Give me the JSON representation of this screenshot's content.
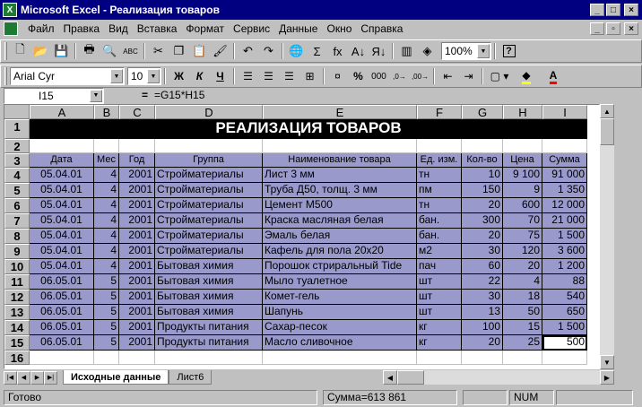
{
  "window": {
    "title": "Microsoft Excel - Реализация товаров",
    "controls": [
      "_",
      "□",
      "×"
    ],
    "doc_controls": [
      "_",
      "▫",
      "×"
    ]
  },
  "menu": [
    "Файл",
    "Правка",
    "Вид",
    "Вставка",
    "Формат",
    "Сервис",
    "Данные",
    "Окно",
    "Справка"
  ],
  "toolbar": {
    "standard": [
      {
        "name": "new-icon",
        "glyph": "🗋"
      },
      {
        "name": "open-icon",
        "glyph": "📂"
      },
      {
        "name": "save-icon",
        "glyph": "💾"
      },
      {
        "name": "print-icon",
        "glyph": "🖶"
      },
      {
        "name": "print-preview-icon",
        "glyph": "🔍"
      },
      {
        "name": "spelling-icon",
        "glyph": "ABC"
      },
      {
        "name": "cut-icon",
        "glyph": "✂"
      },
      {
        "name": "copy-icon",
        "glyph": "❐"
      },
      {
        "name": "paste-icon",
        "glyph": "📋"
      },
      {
        "name": "format-painter-icon",
        "glyph": "🖌"
      },
      {
        "name": "undo-icon",
        "glyph": "↶"
      },
      {
        "name": "redo-icon",
        "glyph": "↷"
      },
      {
        "name": "hyperlink-icon",
        "glyph": "🌐"
      },
      {
        "name": "autosum-icon",
        "glyph": "Σ"
      },
      {
        "name": "function-icon",
        "glyph": "fx"
      },
      {
        "name": "sort-ascending-icon",
        "glyph": "A↓"
      },
      {
        "name": "sort-descending-icon",
        "glyph": "Я↓"
      },
      {
        "name": "chart-wizard-icon",
        "glyph": "▥"
      },
      {
        "name": "drawing-icon",
        "glyph": "◈"
      }
    ],
    "zoom": "100%",
    "help": "?"
  },
  "formatting": {
    "font": "Arial Cyr",
    "size": "10",
    "bold": "Ж",
    "italic": "К",
    "underline": "Ч",
    "currency": "%",
    "thousands": "000",
    "inc_decimal": ",0→,00",
    "dec_decimal": ",00→,0"
  },
  "formula_bar": {
    "name_box": "I15",
    "equals": "=",
    "formula": "=G15*H15"
  },
  "columns": [
    "A",
    "B",
    "C",
    "D",
    "E",
    "F",
    "G",
    "H",
    "I"
  ],
  "row_numbers": [
    "1",
    "2",
    "3",
    "4",
    "5",
    "6",
    "7",
    "8",
    "9",
    "10",
    "11",
    "12",
    "13",
    "14",
    "15",
    "16"
  ],
  "sheet_title": "РЕАЛИЗАЦИЯ ТОВАРОВ",
  "table_headers": [
    "Дата",
    "Мес",
    "Год",
    "Группа",
    "Наименование товара",
    "Ед. изм.",
    "Кол-во",
    "Цена",
    "Сумма"
  ],
  "table_rows": [
    [
      "05.04.01",
      "4",
      "2001",
      "Стройматериалы",
      "Лист 3 мм",
      "тн",
      "10",
      "9 100",
      "91 000"
    ],
    [
      "05.04.01",
      "4",
      "2001",
      "Стройматериалы",
      "Труба Д50, толщ. 3 мм",
      "пм",
      "150",
      "9",
      "1 350"
    ],
    [
      "05.04.01",
      "4",
      "2001",
      "Стройматериалы",
      "Цемент М500",
      "тн",
      "20",
      "600",
      "12 000"
    ],
    [
      "05.04.01",
      "4",
      "2001",
      "Стройматериалы",
      "Краска масляная белая",
      "бан.",
      "300",
      "70",
      "21 000"
    ],
    [
      "05.04.01",
      "4",
      "2001",
      "Стройматериалы",
      "Эмаль белая",
      "бан.",
      "20",
      "75",
      "1 500"
    ],
    [
      "05.04.01",
      "4",
      "2001",
      "Стройматериалы",
      "Кафель для пола 20х20",
      "м2",
      "30",
      "120",
      "3 600"
    ],
    [
      "05.04.01",
      "4",
      "2001",
      "Бытовая химия",
      "Порошок стриральный Tide",
      "пач",
      "60",
      "20",
      "1 200"
    ],
    [
      "06.05.01",
      "5",
      "2001",
      "Бытовая химия",
      "Мыло туалетное",
      "шт",
      "22",
      "4",
      "88"
    ],
    [
      "06.05.01",
      "5",
      "2001",
      "Бытовая химия",
      "Комет-гель",
      "шт",
      "30",
      "18",
      "540"
    ],
    [
      "06.05.01",
      "5",
      "2001",
      "Бытовая химия",
      "Шапунь",
      "шт",
      "13",
      "50",
      "650"
    ],
    [
      "06.05.01",
      "5",
      "2001",
      "Продукты питания",
      "Сахар-песок",
      "кг",
      "100",
      "15",
      "1 500"
    ],
    [
      "06.05.01",
      "5",
      "2001",
      "Продукты питания",
      "Масло сливочное",
      "кг",
      "20",
      "25",
      "500"
    ]
  ],
  "sheet_tabs": [
    "Исходные данные",
    "Лист6"
  ],
  "status": {
    "ready": "Готово",
    "sum": "Сумма=613 861",
    "num": "NUM"
  },
  "colors": {
    "title_bar": "#000080",
    "table_fill": "#9999cc",
    "title_fill": "#000000"
  }
}
